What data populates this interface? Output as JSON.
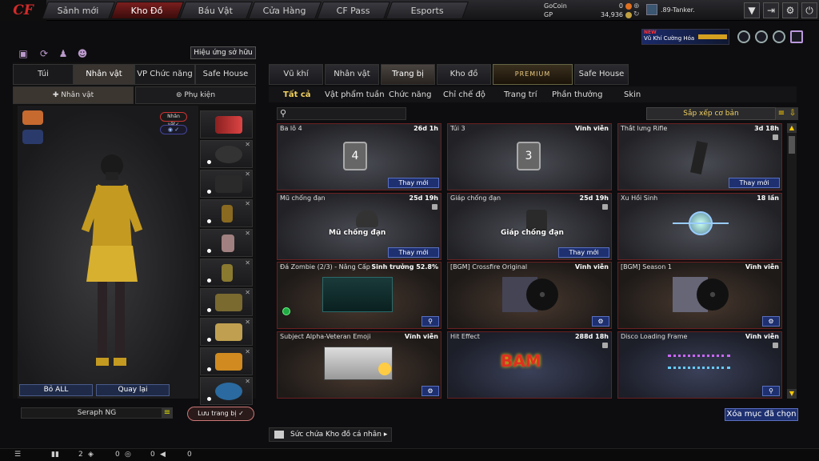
{
  "app": {
    "logo": "CF"
  },
  "nav": [
    {
      "label": "Sảnh mới"
    },
    {
      "label": "Kho Đồ"
    },
    {
      "label": "Báu Vật"
    },
    {
      "label": "Cửa Hàng"
    },
    {
      "label": "CF Pass"
    },
    {
      "label": "Esports"
    }
  ],
  "currency": {
    "gocoin_label": "GoCoin",
    "gocoin_value": "0",
    "gp_label": "GP",
    "gp_value": "34,936"
  },
  "user": {
    "name": ".89-Tanker."
  },
  "promo": {
    "badge": "NEW",
    "text": "Vũ Khí Cường Hóa"
  },
  "left": {
    "effect_button": "Hiệu ứng sở hữu",
    "tabs": [
      "Túi",
      "Nhân vật",
      "VP Chức năng",
      "Safe House"
    ],
    "subtabs": [
      "Nhân vật",
      "Phụ kiện"
    ],
    "char_badge": "Nhân vật",
    "clear_all": "Bỏ ALL",
    "back": "Quay lại",
    "character_name": "Seraph NG",
    "save": "Lưu trang bị"
  },
  "right": {
    "tabs": [
      "Vũ khí",
      "Nhân vật",
      "Trang bị",
      "Kho đồ",
      "PREMIUM",
      "Safe House"
    ],
    "subtabs": [
      "Tất cả",
      "Vật phẩm tuần",
      "Chức năng",
      "Chỉ chế độ",
      "Trang trí",
      "Phần thưởng",
      "Skin"
    ],
    "sort_label": "Sắp xếp cơ bản",
    "clear_selected": "Xóa mục đã chọn",
    "capacity_label": "Sức chứa Kho đồ cá nhân"
  },
  "items": [
    {
      "name": "Ba lô 4",
      "time": "26d 1h",
      "action": "Thay mới",
      "image_text": "4"
    },
    {
      "name": "Túi 3",
      "time": "Vĩnh viễn",
      "action": "",
      "image_text": "3"
    },
    {
      "name": "Thắt lưng Rifle",
      "time": "3d 18h",
      "action": "Thay mới",
      "image_text": ""
    },
    {
      "name": "Mũ chống đạn",
      "time": "25d 19h",
      "action": "Thay mới",
      "image_text": "Mũ chống đạn"
    },
    {
      "name": "Giáp chống đạn",
      "time": "25d 19h",
      "action": "Thay mới",
      "image_text": "Giáp chống đạn"
    },
    {
      "name": "Xu Hồi Sinh",
      "time": "18 lần",
      "action": "",
      "image_text": ""
    },
    {
      "name": "Đá Zombie (2/3) - Nâng Cấp",
      "time": "Sinh trưởng 52.8%",
      "action": "",
      "image_text": ""
    },
    {
      "name": "[BGM] Crossfire Original",
      "time": "Vĩnh viễn",
      "action": "",
      "image_text": ""
    },
    {
      "name": "[BGM] Season 1",
      "time": "Vĩnh viễn",
      "action": "",
      "image_text": ""
    },
    {
      "name": "Subject Alpha-Veteran Emoji",
      "time": "Vĩnh viễn",
      "action": "",
      "image_text": ""
    },
    {
      "name": "Hit Effect",
      "time": "288d 18h",
      "action": "",
      "image_text": "BAM"
    },
    {
      "name": "Disco Loading Frame",
      "time": "Vĩnh viễn",
      "action": "",
      "image_text": ""
    }
  ],
  "bottom": {
    "count1": "2",
    "count2": "0",
    "count3": "0",
    "count4": "0"
  }
}
